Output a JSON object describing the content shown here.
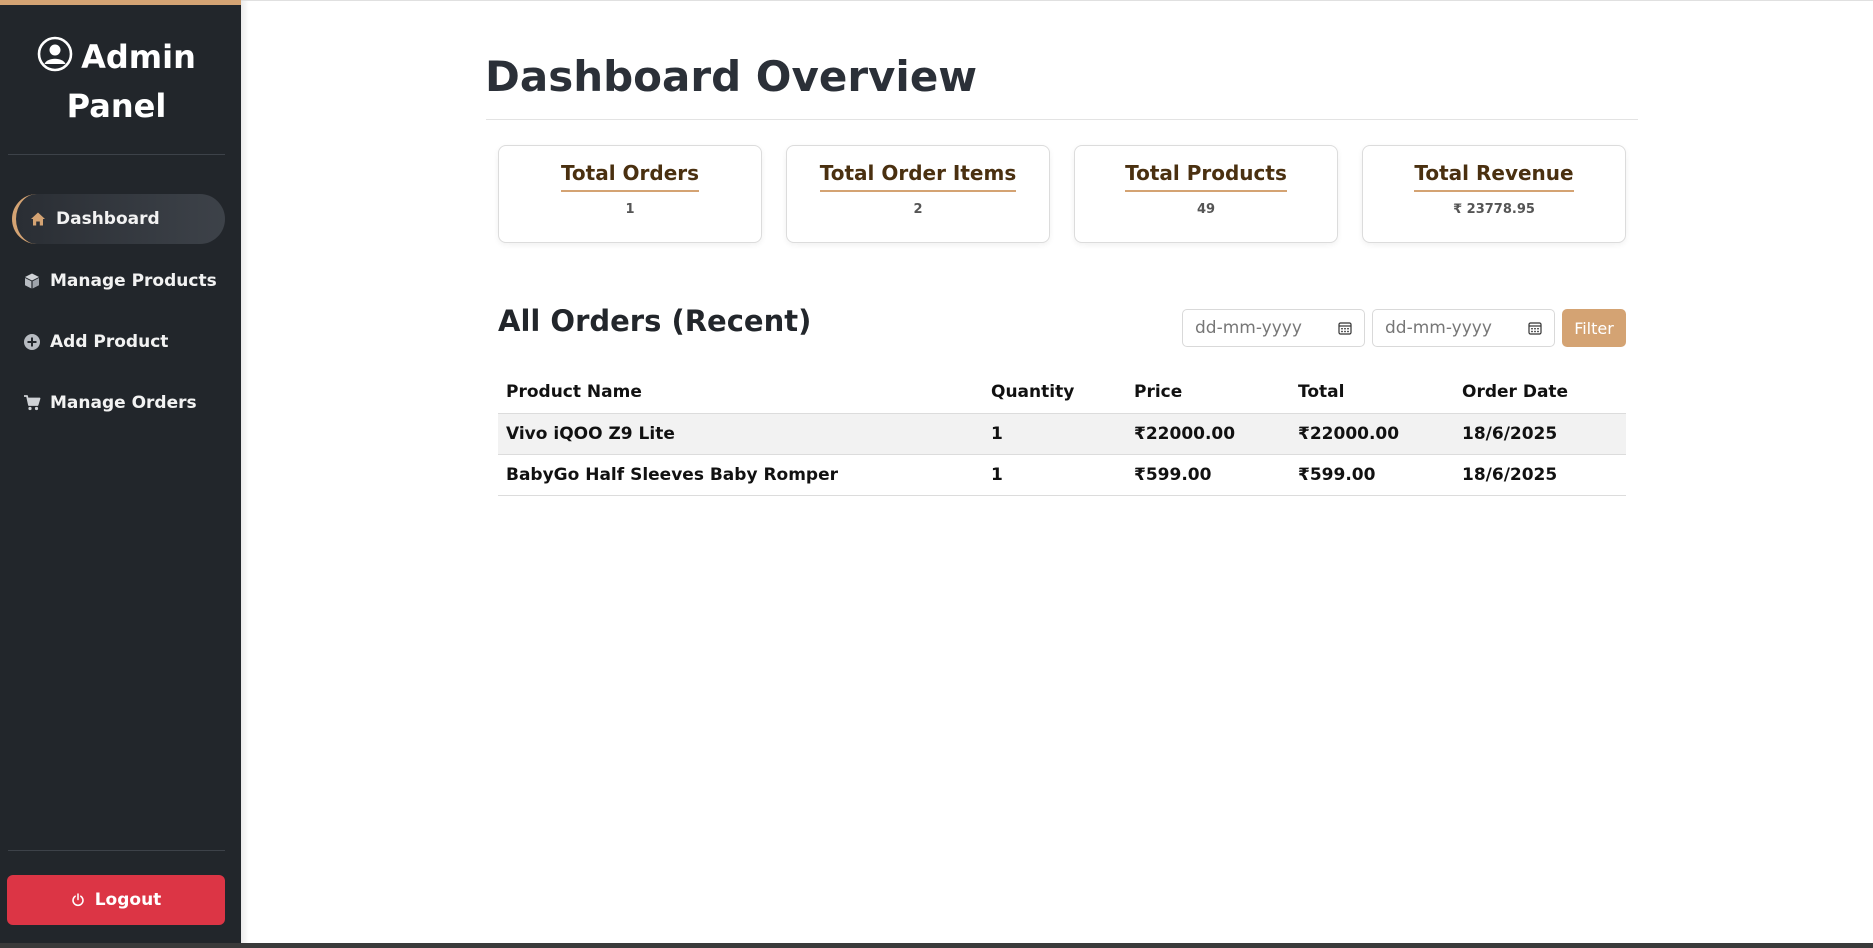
{
  "sidebar": {
    "brand_line1": "Admin",
    "brand_line2": "Panel",
    "items": [
      {
        "label": "Dashboard",
        "icon": "home-icon"
      },
      {
        "label": "Manage Products",
        "icon": "box-icon"
      },
      {
        "label": "Add Product",
        "icon": "plus-circle-icon"
      },
      {
        "label": "Manage Orders",
        "icon": "cart-icon"
      }
    ],
    "logout_label": "Logout"
  },
  "main": {
    "title": "Dashboard Overview",
    "stats": [
      {
        "label": "Total Orders",
        "value": "1"
      },
      {
        "label": "Total Order Items",
        "value": "2"
      },
      {
        "label": "Total Products",
        "value": "49"
      },
      {
        "label": "Total Revenue",
        "value": "₹ 23778.95"
      }
    ],
    "orders": {
      "heading": "All Orders (Recent)",
      "date_from_placeholder": "dd-mm-yyyy",
      "date_to_placeholder": "dd-mm-yyyy",
      "filter_label": "Filter",
      "columns": [
        "Product Name",
        "Quantity",
        "Price",
        "Total",
        "Order Date"
      ],
      "rows": [
        {
          "product": "Vivo iQOO Z9 Lite",
          "quantity": "1",
          "price": "₹22000.00",
          "total": "₹22000.00",
          "date": "18/6/2025"
        },
        {
          "product": "BabyGo Half Sleeves Baby Romper",
          "quantity": "1",
          "price": "₹599.00",
          "total": "₹599.00",
          "date": "18/6/2025"
        }
      ]
    }
  },
  "colors": {
    "sidebar_bg": "#22262b",
    "accent": "#d4a373",
    "logout": "#dc3545",
    "card_title": "#4a3010"
  }
}
